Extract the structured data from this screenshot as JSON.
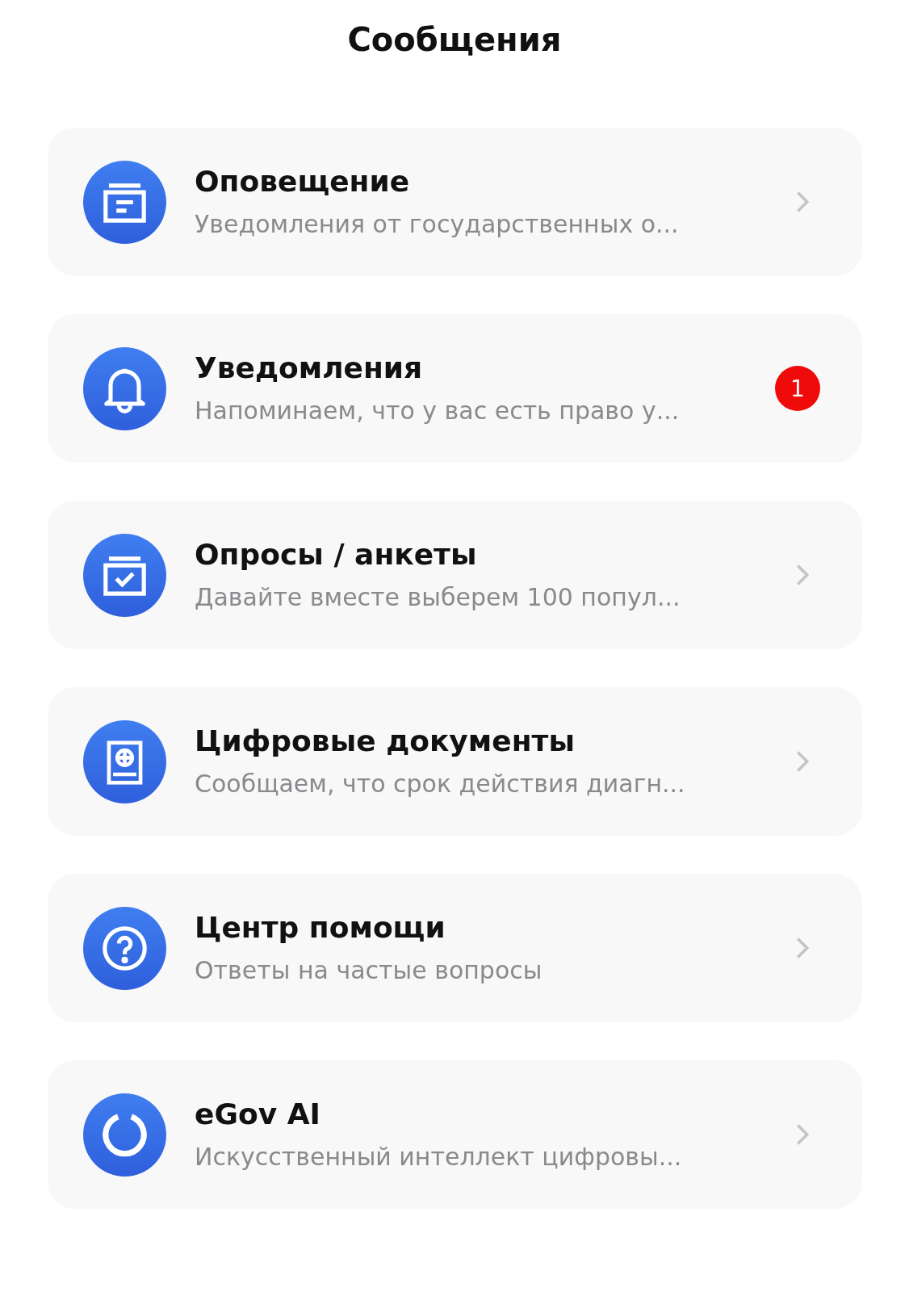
{
  "header": {
    "title": "Сообщения"
  },
  "items": [
    {
      "title": "Оповещение",
      "subtitle": "Уведомления от государственных о...",
      "kind": "chevron"
    },
    {
      "title": "Уведомления",
      "subtitle": "Напоминаем, что у вас есть право у...",
      "kind": "badge",
      "badge": "1"
    },
    {
      "title": "Опросы / анкеты",
      "subtitle": "Давайте вместе выберем 100 попул...",
      "kind": "chevron"
    },
    {
      "title": "Цифровые документы",
      "subtitle": "Сообщаем, что срок действия диагн...",
      "kind": "chevron"
    },
    {
      "title": "Центр помощи",
      "subtitle": "Ответы на частые вопросы",
      "kind": "chevron"
    },
    {
      "title": "eGov AI",
      "subtitle": "Искусственный интеллект цифровы...",
      "kind": "chevron"
    }
  ]
}
